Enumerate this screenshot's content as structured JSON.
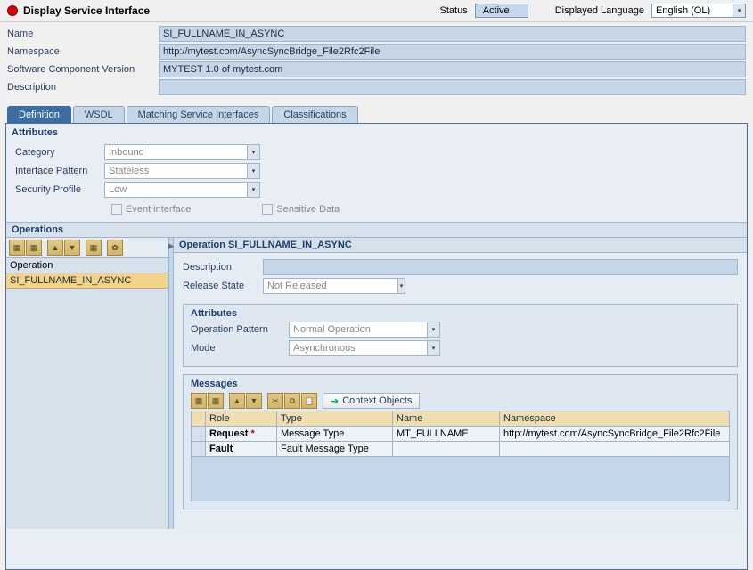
{
  "header": {
    "title": "Display Service Interface",
    "status_label": "Status",
    "status_value": "Active",
    "lang_label": "Displayed Language",
    "lang_value": "English (OL)"
  },
  "form": {
    "name_label": "Name",
    "name_value": "SI_FULLNAME_IN_ASYNC",
    "ns_label": "Namespace",
    "ns_value": "http://mytest.com/AsyncSyncBridge_File2Rfc2File",
    "scv_label": "Software Component Version",
    "scv_value": "MYTEST 1.0 of mytest.com",
    "desc_label": "Description",
    "desc_value": ""
  },
  "tabs": [
    "Definition",
    "WSDL",
    "Matching Service Interfaces",
    "Classifications"
  ],
  "attributes": {
    "title": "Attributes",
    "category_label": "Category",
    "category_value": "Inbound",
    "pattern_label": "Interface Pattern",
    "pattern_value": "Stateless",
    "security_label": "Security Profile",
    "security_value": "Low",
    "event_label": "Event interface",
    "sensitive_label": "Sensitive Data"
  },
  "operations": {
    "title": "Operations",
    "left_header": "Operation",
    "left_item": "SI_FULLNAME_IN_ASYNC",
    "right_title": "Operation SI_FULLNAME_IN_ASYNC",
    "desc_label": "Description",
    "desc_value": "",
    "release_label": "Release State",
    "release_value": "Not Released"
  },
  "op_attrs": {
    "title": "Attributes",
    "pattern_label": "Operation Pattern",
    "pattern_value": "Normal Operation",
    "mode_label": "Mode",
    "mode_value": "Asynchronous"
  },
  "messages": {
    "title": "Messages",
    "context_btn": "Context Objects",
    "cols": [
      "Role",
      "Type",
      "Name",
      "Namespace"
    ],
    "rows": [
      {
        "role": "Request",
        "required": true,
        "type": "Message Type",
        "name": "MT_FULLNAME",
        "ns": "http://mytest.com/AsyncSyncBridge_File2Rfc2File"
      },
      {
        "role": "Fault",
        "required": false,
        "type": "Fault Message Type",
        "name": "",
        "ns": ""
      }
    ]
  }
}
